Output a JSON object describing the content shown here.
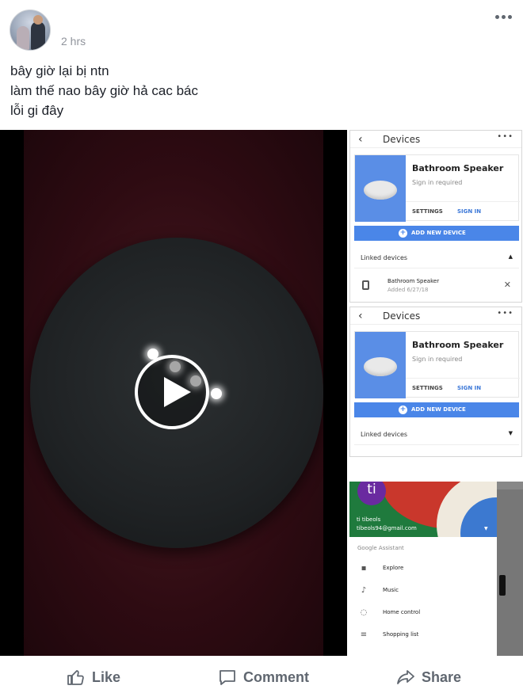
{
  "post": {
    "timestamp": "2 hrs",
    "text_lines": [
      "bây giờ lại bị ntn",
      "làm thế nao bây giờ hả cac bác",
      "lỗi gi đây"
    ],
    "more_icon": "ellipsis-icon"
  },
  "video": {
    "play_icon": "play-icon"
  },
  "screenshots": [
    {
      "header_title": "Devices",
      "device_name": "Bathroom Speaker",
      "device_status": "Sign in required",
      "settings_label": "SETTINGS",
      "signin_label": "SIGN IN",
      "add_device_label": "ADD NEW DEVICE",
      "linked_label": "Linked devices",
      "linked_device_name": "Bathroom Speaker",
      "linked_device_added": "Added 6/27/18"
    },
    {
      "header_title": "Devices",
      "device_name": "Bathroom Speaker",
      "device_status": "Sign in required",
      "settings_label": "SETTINGS",
      "signin_label": "SIGN IN",
      "add_device_label": "ADD NEW DEVICE",
      "linked_label": "Linked devices"
    }
  ],
  "assistant": {
    "avatar_letter": "ti",
    "account_name": "ti tibeols",
    "account_email": "tibeols94@gmail.com",
    "section_label": "Google Assistant",
    "menu": [
      "Explore",
      "Music",
      "Home control",
      "Shopping list"
    ]
  },
  "actions": {
    "like": "Like",
    "comment": "Comment",
    "share": "Share"
  }
}
